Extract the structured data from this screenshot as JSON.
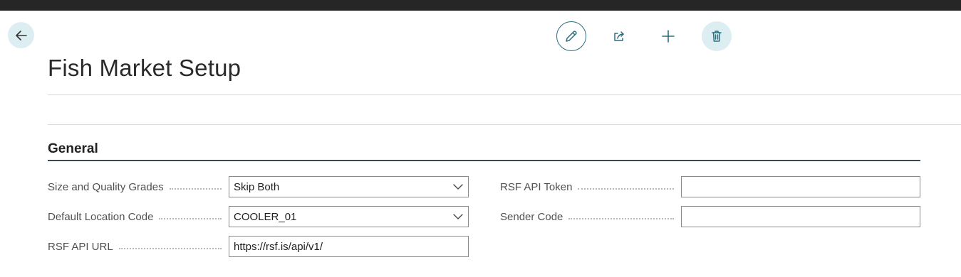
{
  "page": {
    "title": "Fish Market Setup"
  },
  "actions": {
    "back": "back-arrow-icon",
    "edit": "pencil-icon",
    "share": "share-icon",
    "new": "plus-icon",
    "delete": "trash-icon"
  },
  "section": {
    "title": "General"
  },
  "fields": {
    "size_quality": {
      "label": "Size and Quality Grades",
      "value": "Skip Both"
    },
    "default_location": {
      "label": "Default Location Code",
      "value": "COOLER_01"
    },
    "api_url": {
      "label": "RSF API URL",
      "value": "https://rsf.is/api/v1/"
    },
    "api_token": {
      "label": "RSF API Token",
      "value": ""
    },
    "sender_code": {
      "label": "Sender Code",
      "value": ""
    }
  },
  "colors": {
    "accent": "#2b6f7f",
    "accent_bg": "#ddeef2",
    "topbar": "#262626"
  }
}
